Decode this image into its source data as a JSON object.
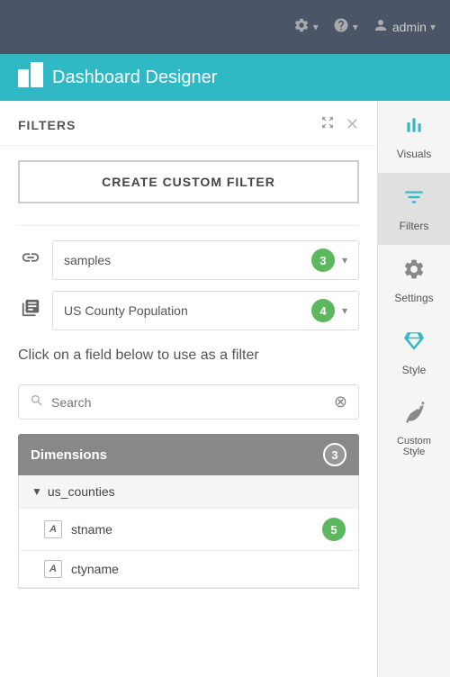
{
  "topNav": {
    "settingsLabel": "⚙",
    "helpLabel": "?",
    "adminLabel": "admin",
    "chevron": "▾"
  },
  "header": {
    "logoSymbol": "▪▪",
    "title": "Dashboard Designer"
  },
  "filtersPanel": {
    "title": "FILTERS",
    "expandIcon": "⤢",
    "closeIcon": "✕",
    "createButtonLabel": "CREATE CUSTOM FILTER",
    "datasource": {
      "label": "samples",
      "badge": "3"
    },
    "dataset": {
      "label": "US County Population",
      "badge": "4"
    },
    "instructionText": "Click on a field below to use as a filter",
    "search": {
      "placeholder": "Search"
    },
    "dimensions": {
      "label": "Dimensions",
      "badge": "3",
      "groups": [
        {
          "name": "us_counties",
          "fields": [
            {
              "type": "A",
              "name": "stname",
              "badge": "5"
            },
            {
              "type": "A",
              "name": "ctyname",
              "badge": null
            }
          ]
        }
      ]
    }
  },
  "rightSidebar": {
    "items": [
      {
        "id": "visuals",
        "label": "Visuals",
        "icon": "bar-chart"
      },
      {
        "id": "filters",
        "label": "Filters",
        "icon": "filter",
        "active": true
      },
      {
        "id": "settings",
        "label": "Settings",
        "icon": "gear"
      },
      {
        "id": "style",
        "label": "Style",
        "icon": "diamond"
      },
      {
        "id": "custom-style",
        "label": "Custom Style",
        "icon": "leaf"
      }
    ]
  }
}
